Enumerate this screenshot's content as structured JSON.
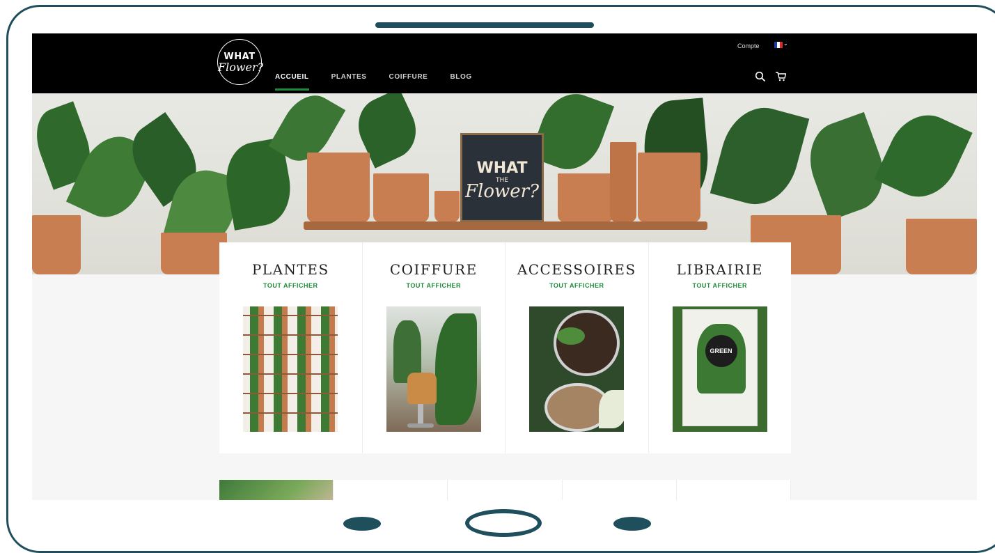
{
  "header": {
    "logo_top": "WHAT",
    "logo_bottom": "Flower?",
    "menu": [
      {
        "label": "ACCUEIL",
        "active": true
      },
      {
        "label": "PLANTES",
        "active": false
      },
      {
        "label": "COIFFURE",
        "active": false
      },
      {
        "label": "BLOG",
        "active": false
      }
    ],
    "account": "Compte",
    "language_flag": "fr-flag-icon",
    "icons": [
      "search-icon",
      "cart-icon"
    ]
  },
  "hero": {
    "sign_top": "WHAT",
    "sign_middle": "THE",
    "sign_bottom": "Flower?"
  },
  "categories": [
    {
      "title": "PLANTES",
      "link": "TOUT AFFICHER",
      "image": "plant-wall-photo"
    },
    {
      "title": "COIFFURE",
      "link": "TOUT AFFICHER",
      "image": "salon-chair-photo"
    },
    {
      "title": "ACCESSOIRES",
      "link": "TOUT AFFICHER",
      "image": "repotting-photo"
    },
    {
      "title": "LIBRAIRIE",
      "link": "TOUT AFFICHER",
      "image": "book-cover-photo"
    }
  ],
  "book_cover_text": "GREEN",
  "colors": {
    "frame": "#1f4f5c",
    "accent": "#1e8a3c",
    "header_bg": "#000000"
  }
}
